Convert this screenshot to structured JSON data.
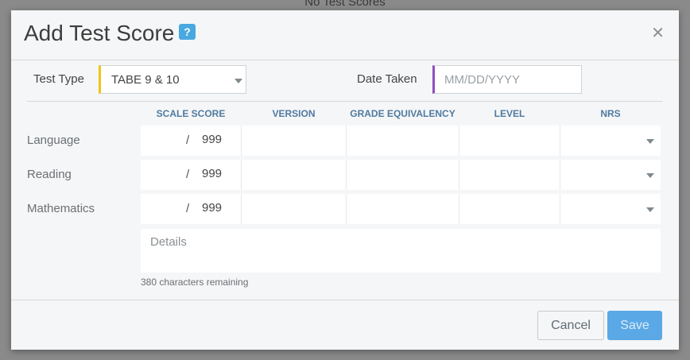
{
  "backdrop": {
    "text": "No Test Scores"
  },
  "modal": {
    "title": "Add Test Score",
    "help_badge": "?",
    "close_icon": "close-icon"
  },
  "form": {
    "test_type": {
      "label": "Test Type",
      "value": "TABE 9 & 10"
    },
    "date_taken": {
      "label": "Date Taken",
      "placeholder": "MM/DD/YYYY",
      "value": ""
    }
  },
  "columns": [
    "SCALE SCORE",
    "VERSION",
    "GRADE EQUIVALENCY",
    "LEVEL",
    "NRS"
  ],
  "rows": [
    {
      "label": "Language",
      "separator": "/",
      "max": "999"
    },
    {
      "label": "Reading",
      "separator": "/",
      "max": "999"
    },
    {
      "label": "Mathematics",
      "separator": "/",
      "max": "999"
    }
  ],
  "details": {
    "placeholder": "Details",
    "remaining": "380 characters remaining"
  },
  "footer": {
    "cancel_label": "Cancel",
    "save_label": "Save"
  },
  "colors": {
    "test_type_accent": "#f0c419",
    "date_accent": "#8e4fc0",
    "header_blue": "#4f7aa0",
    "save_button": "#5aa9e6",
    "help_badge": "#4aa8e0"
  }
}
